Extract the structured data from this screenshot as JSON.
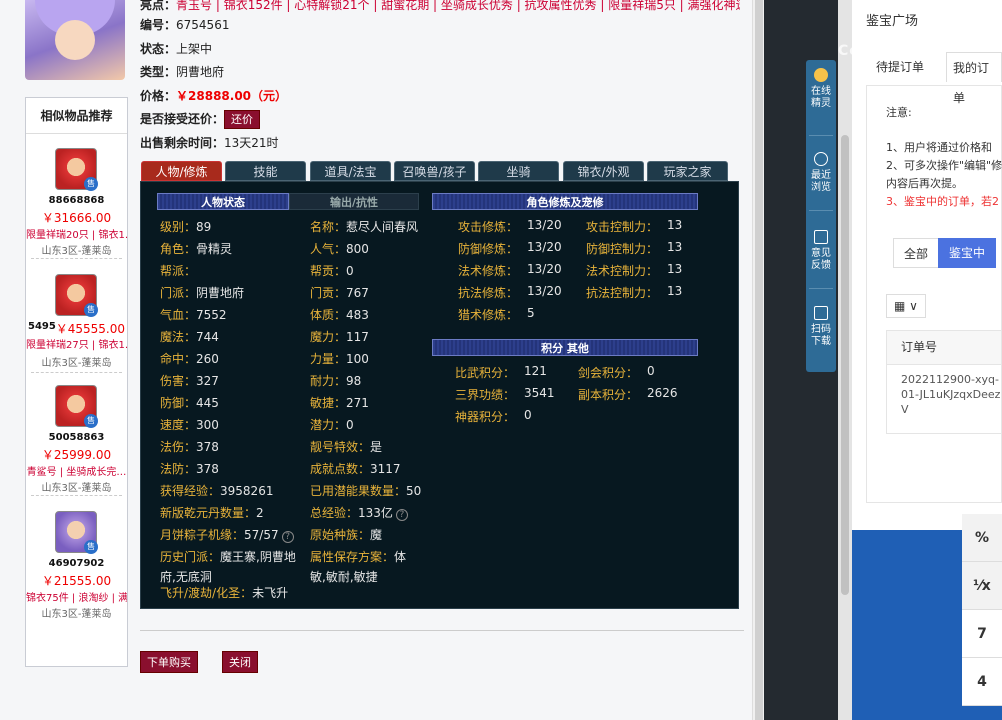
{
  "header": {
    "highlights_label": "亮点：",
    "highlights": "青玉号 | 锦衣152件 | 心特解锁21个 | 甜蜜花期 | 坐骑成长优秀 | 抗攻属性优秀 | 限量祥瑞5只 | 满强化神速",
    "serial_label": "编号：",
    "serial": "6754561",
    "status_label": "状态：",
    "status": "上架中",
    "type_label": "类型：",
    "type": "阴曹地府",
    "price_label": "价格：",
    "price": "￥28888.00（元）",
    "bargain_label": "是否接受还价：",
    "bargain_btn": "还价",
    "remaining_label": "出售剩余时间：",
    "remaining": "13天21时"
  },
  "recommend": {
    "title": "相似物品推荐",
    "items": [
      {
        "id": "88668868",
        "price": "￥31666.00",
        "tags": "限量祥瑞20只 | 锦衣1…",
        "server": "山东3区-蓬莱岛"
      },
      {
        "id": "5495",
        "price": "￥45555.00",
        "tags": "限量祥瑞27只 | 锦衣1…",
        "server": "山东3区-蓬莱岛"
      },
      {
        "id": "50058863",
        "price": "￥25999.00",
        "tags": "青鲨号 | 坐骑成长完…",
        "server": "山东3区-蓬莱岛"
      },
      {
        "id": "46907902",
        "price": "￥21555.00",
        "tags": "锦衣75件 | 浪淘纱 | 满…",
        "server": "山东3区-蓬莱岛"
      }
    ],
    "sell_badge": "售"
  },
  "tabs": [
    "人物/修炼",
    "技能",
    "道具/法宝",
    "召唤兽/孩子",
    "坐骑",
    "锦衣/外观",
    "玩家之家"
  ],
  "panel": {
    "h_status": "人物状态",
    "h_output": "输出/抗性",
    "h_cultivation": "角色修炼及宠修",
    "h_points": "积分 其他",
    "left_col": [
      [
        "级别：",
        "89"
      ],
      [
        "角色：",
        "骨精灵"
      ],
      [
        "帮派：",
        ""
      ],
      [
        "门派：",
        "阴曹地府"
      ],
      [
        "气血：",
        "7552"
      ],
      [
        "魔法：",
        "744"
      ],
      [
        "命中：",
        "260"
      ],
      [
        "伤害：",
        "327"
      ],
      [
        "防御：",
        "445"
      ],
      [
        "速度：",
        "300"
      ],
      [
        "法伤：",
        "378"
      ],
      [
        "法防：",
        "378"
      ],
      [
        "获得经验：",
        "3958261"
      ],
      [
        "新版乾元丹数量：",
        "2"
      ],
      [
        "月饼粽子机缘：",
        "57/57"
      ],
      [
        "历史门派：",
        "魔王寨,阴曹地"
      ],
      [
        "",
        "府,无底洞"
      ],
      [
        "飞升/渡劫/化圣：",
        "未飞升"
      ]
    ],
    "mid_col": [
      [
        "名称：",
        "惹尽人间春风"
      ],
      [
        "人气：",
        "800"
      ],
      [
        "帮贡：",
        "0"
      ],
      [
        "门贡：",
        "767"
      ],
      [
        "体质：",
        "483"
      ],
      [
        "魔力：",
        "117"
      ],
      [
        "力量：",
        "100"
      ],
      [
        "耐力：",
        "98"
      ],
      [
        "敏捷：",
        "271"
      ],
      [
        "潜力：",
        "0"
      ],
      [
        "靓号特效：",
        "是"
      ],
      [
        "成就点数：",
        "3117"
      ],
      [
        "已用潜能果数量：",
        "50"
      ],
      [
        "总经验：",
        "133亿"
      ],
      [
        "原始种族：",
        "魔"
      ],
      [
        "属性保存方案：",
        "体"
      ],
      [
        "",
        "敏,敏耐,敏捷"
      ]
    ],
    "cult": [
      [
        "攻击修炼：",
        "13/20",
        "攻击控制力：",
        "13"
      ],
      [
        "防御修炼：",
        "13/20",
        "防御控制力：",
        "13"
      ],
      [
        "法术修炼：",
        "13/20",
        "法术控制力：",
        "13"
      ],
      [
        "抗法修炼：",
        "13/20",
        "抗法控制力：",
        "13"
      ],
      [
        "猎术修炼：",
        "5",
        "",
        ""
      ]
    ],
    "points": [
      [
        "比武积分：",
        "121",
        "剑会积分：",
        "0"
      ],
      [
        "三界功绩：",
        "3541",
        "副本积分：",
        "2626"
      ],
      [
        "神器积分：",
        "0",
        "",
        ""
      ]
    ],
    "help_icon": "?"
  },
  "actions": {
    "buy": "下单购买",
    "close": "关闭"
  },
  "sidetools": [
    {
      "label1": "在线",
      "label2": "精灵",
      "icon": "robot-icon"
    },
    {
      "label1": "最近",
      "label2": "浏览",
      "icon": "clock-icon"
    },
    {
      "label1": "意见",
      "label2": "反馈",
      "icon": "edit-icon"
    },
    {
      "label1": "扫码",
      "label2": "下载",
      "icon": "scan-icon"
    }
  ],
  "right": {
    "title": "鉴宝广场",
    "tab_pending": "待提订单",
    "tab_mine": "我的订单",
    "note_title": "注意:",
    "notes": [
      "1、用户将通过价格和",
      "2、可多次操作\"编辑\"修",
      "内容后再次提。"
    ],
    "note_red": "3、鉴宝中的订单，若2",
    "btn_all": "全部",
    "btn_jb": "鉴宝中",
    "grid_icon": "▦ ∨",
    "col_order": "订单号",
    "order_id": "2022112900-xyq-01-JL1uKJzqxDeezV",
    "cells": [
      "%",
      "⅟x",
      "7",
      "4"
    ],
    "watermark": "CoLi 鉴宝"
  },
  "colors": {
    "accent_red": "#8a0f2e",
    "panel_bg": "#071820",
    "label_gold": "#e8b33a",
    "blue": "#4b72e0"
  }
}
